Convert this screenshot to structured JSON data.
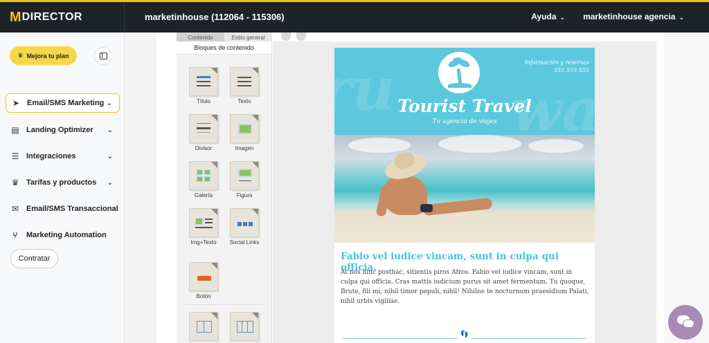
{
  "brand": {
    "mark": "M",
    "name": "DIRECTOR"
  },
  "header": {
    "account": "marketinhouse (112064 - 115306)",
    "help": "Ayuda",
    "user": "marketinhouse agencia",
    "accent": "#f0c419"
  },
  "sidebar": {
    "upgrade_label": "Mejora tu plan",
    "items": [
      {
        "label": "Email/SMS Marketing",
        "icon": "send-icon"
      },
      {
        "label": "Landing Optimizer",
        "icon": "document-icon"
      },
      {
        "label": "Integraciones",
        "icon": "list-icon"
      },
      {
        "label": "Tarifas y productos",
        "icon": "crown-icon"
      },
      {
        "label": "Email/SMS Transaccional",
        "icon": "envelope-icon"
      },
      {
        "label": "Marketing Automation",
        "icon": "flow-icon"
      }
    ],
    "contract_label": "Contratar"
  },
  "editor": {
    "tabs": [
      "Contenido",
      "Estilo general"
    ],
    "blocks_title": "Bloques de contenido",
    "blocks": [
      "Título",
      "Texto",
      "Divisor",
      "Imagen",
      "Galería",
      "Figura",
      "Img+Texto",
      "Social Links",
      "Botón"
    ]
  },
  "email": {
    "info_line1": "Información y reservas",
    "info_line2": "555 555 555",
    "title": "Tourist Travel",
    "subtitle": "Tu agencia de viajes",
    "headline": "Fabio vel iudice vincam, sunt in culpa qui officia.",
    "body": "At nos hinc posthac, sitientis piros Afros. Fabio vel iudice vincam, sunt in culpa qui officia. Cras mattis iudicium purus sit amet fermentum. Tu quoque, Brute, fili mi, nihil timor populi, nihil! Nihilne te nocturnum praesidium Palati, nihil urbis vigiliae.",
    "accent": "#5bc8dd"
  }
}
